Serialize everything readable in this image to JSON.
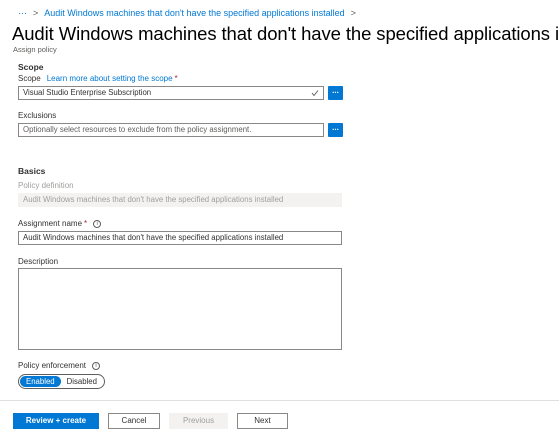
{
  "breadcrumb": {
    "ellipsis": "···",
    "separator": ">",
    "item": "Audit Windows machines that don't have the specified applications installed",
    "trailing": ">"
  },
  "header": {
    "title": "Audit Windows machines that don't have the specified applications installed",
    "subtitle": "Assign policy"
  },
  "scope": {
    "section_title": "Scope",
    "label": "Scope",
    "learn_more": "Learn more about setting the scope",
    "required": "*",
    "value": "Visual Studio Enterprise Subscription",
    "browse_label": "..."
  },
  "exclusions": {
    "label": "Exclusions",
    "placeholder": "Optionally select resources to exclude from the policy assignment.",
    "browse_label": "..."
  },
  "basics": {
    "section_title": "Basics",
    "policy_definition_label": "Policy definition",
    "policy_definition_value": "Audit Windows machines that don't have the specified applications installed",
    "assignment_name_label": "Assignment name",
    "assignment_name_required": "*",
    "assignment_name_value": "Audit Windows machines that don't have the specified applications installed",
    "description_label": "Description",
    "description_value": ""
  },
  "enforcement": {
    "label": "Policy enforcement",
    "options": [
      "Enabled",
      "Disabled"
    ],
    "selected": "Enabled"
  },
  "footer": {
    "review_create": "Review + create",
    "cancel": "Cancel",
    "previous": "Previous",
    "next": "Next"
  },
  "colors": {
    "accent": "#0078d4",
    "required": "#a4262c",
    "disabled_bg": "#f3f2f1"
  },
  "icons": {
    "chevron": "chevron-down-icon",
    "info": "info-icon",
    "check": "check-icon"
  }
}
